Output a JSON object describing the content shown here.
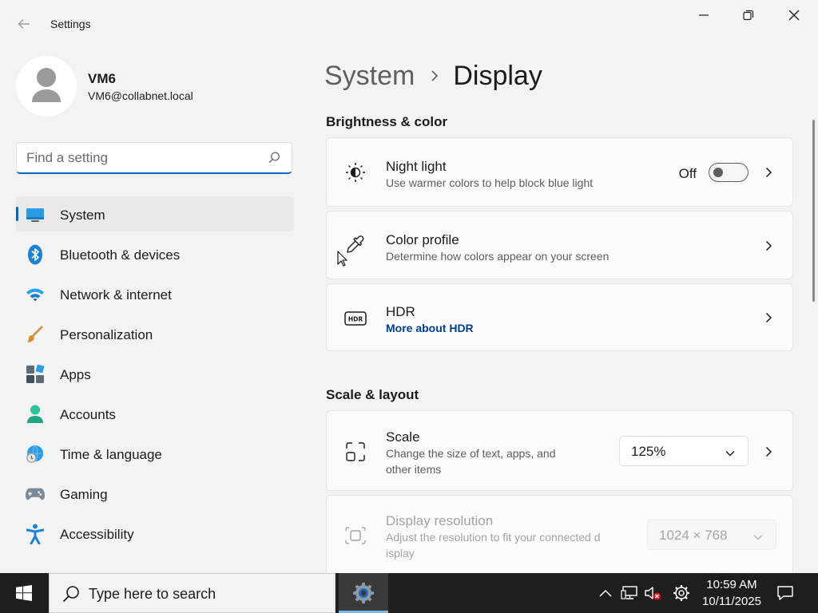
{
  "window": {
    "app_title": "Settings"
  },
  "profile": {
    "name": "VM6",
    "email": "VM6@collabnet.local"
  },
  "search": {
    "placeholder": "Find a setting"
  },
  "sidebar": {
    "items": [
      {
        "label": "System",
        "icon": "system-display-icon",
        "active": true
      },
      {
        "label": "Bluetooth & devices",
        "icon": "bluetooth-icon"
      },
      {
        "label": "Network & internet",
        "icon": "wifi-icon"
      },
      {
        "label": "Personalization",
        "icon": "paintbrush-icon"
      },
      {
        "label": "Apps",
        "icon": "apps-icon"
      },
      {
        "label": "Accounts",
        "icon": "accounts-icon"
      },
      {
        "label": "Time & language",
        "icon": "globe-clock-icon"
      },
      {
        "label": "Gaming",
        "icon": "gamepad-icon"
      },
      {
        "label": "Accessibility",
        "icon": "accessibility-icon"
      }
    ]
  },
  "breadcrumb": {
    "parent": "System",
    "current": "Display"
  },
  "sections": {
    "brightness": {
      "title": "Brightness & color",
      "night_light": {
        "title": "Night light",
        "subtitle": "Use warmer colors to help block blue light",
        "state": "Off"
      },
      "color_profile": {
        "title": "Color profile",
        "subtitle": "Determine how colors appear on your screen"
      },
      "hdr": {
        "title": "HDR",
        "link": "More about HDR"
      }
    },
    "scale_layout": {
      "title": "Scale & layout",
      "scale": {
        "title": "Scale",
        "subtitle_line1": "Change the size of text, apps, and",
        "subtitle_line2": "other items",
        "value": "125%"
      },
      "resolution": {
        "title": "Display resolution",
        "subtitle_line1": "Adjust the resolution to fit your connected d",
        "subtitle_line2": "isplay",
        "value": "1024 × 768"
      }
    }
  },
  "taskbar": {
    "search_text": "Type here to search",
    "time": "10:59 AM",
    "date": "10/11/2025"
  },
  "colors": {
    "accent": "#0067c0",
    "link": "#003e92",
    "taskbar": "#1e1e1e"
  }
}
